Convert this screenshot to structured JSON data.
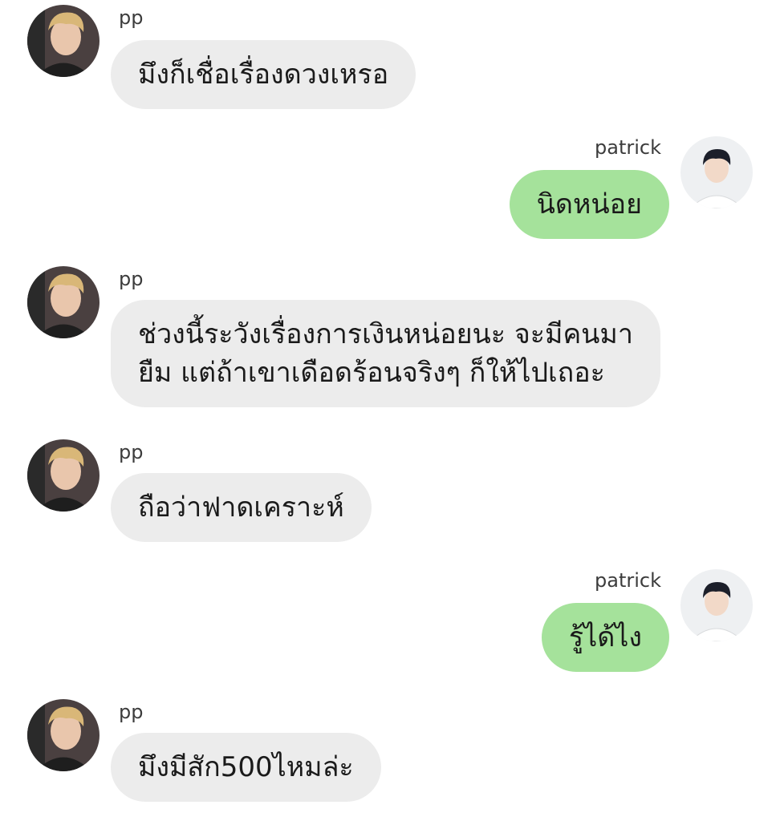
{
  "chat": {
    "colors": {
      "incoming_bubble": "#ececec",
      "outgoing_bubble": "#a5e29b",
      "background": "#ffffff"
    },
    "messages": [
      {
        "sender": "pp",
        "direction": "incoming",
        "avatar": "pp-avatar",
        "lines": [
          "มึงก็เชื่อเรื่องดวงเหรอ"
        ]
      },
      {
        "sender": "patrick",
        "direction": "outgoing",
        "avatar": "patrick-avatar",
        "lines": [
          "นิดหน่อย"
        ]
      },
      {
        "sender": "pp",
        "direction": "incoming",
        "avatar": "pp-avatar",
        "lines": [
          "ช่วงนี้ระวังเรื่องการเงินหน่อยนะ จะมีคนมา",
          "ยืม แต่ถ้าเขาเดือดร้อนจริงๆ ก็ให้ไปเถอะ"
        ]
      },
      {
        "sender": "pp",
        "direction": "incoming",
        "avatar": "pp-avatar",
        "lines": [
          "ถือว่าฟาดเคราะห์"
        ]
      },
      {
        "sender": "patrick",
        "direction": "outgoing",
        "avatar": "patrick-avatar",
        "lines": [
          "รู้ได้ไง"
        ]
      },
      {
        "sender": "pp",
        "direction": "incoming",
        "avatar": "pp-avatar",
        "lines": [
          "มึงมีสัก500ไหมล่ะ"
        ]
      }
    ]
  }
}
